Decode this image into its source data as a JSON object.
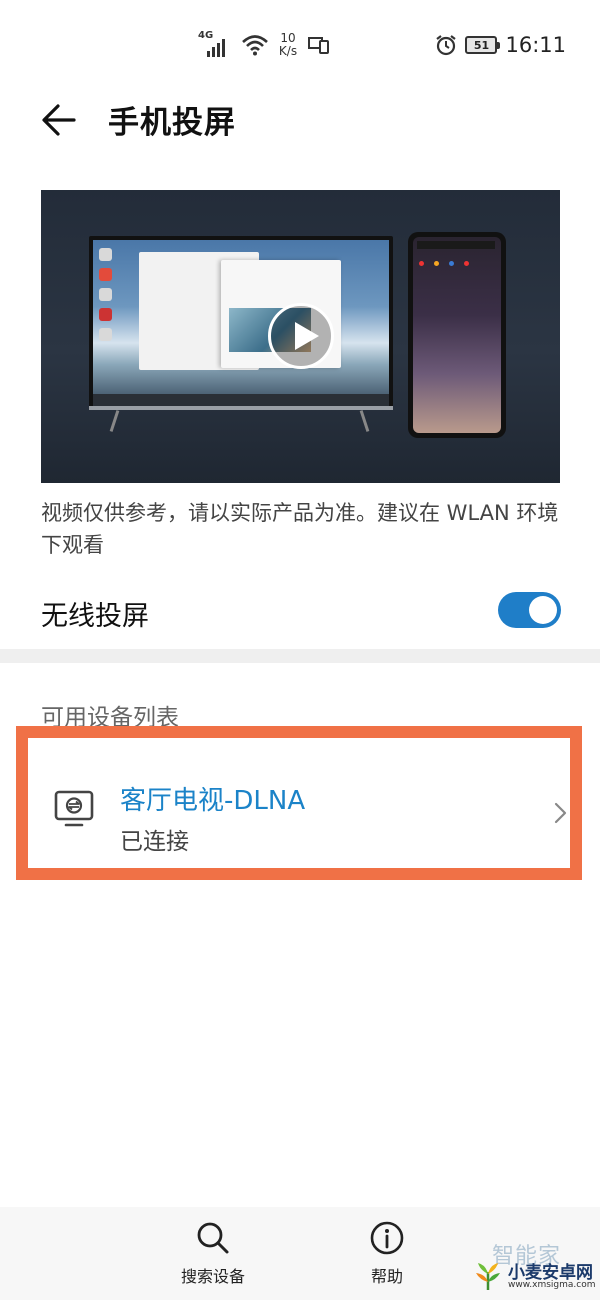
{
  "status_bar": {
    "network_type": "4G",
    "speed_value": "10",
    "speed_unit": "K/s",
    "battery": "51",
    "time": "16:11"
  },
  "header": {
    "title": "手机投屏"
  },
  "video": {
    "note": "视频仅供参考，请以实际产品为准。建议在 WLAN 环境下观看"
  },
  "wireless": {
    "label": "无线投屏",
    "enabled": true,
    "accent_color": "#1f7ec8"
  },
  "devices": {
    "section_title": "可用设备列表",
    "items": [
      {
        "name": "客厅电视-DLNA",
        "status": "已连接",
        "icon": "tv-cast-icon"
      }
    ],
    "highlight_color": "#f07146"
  },
  "bottom_bar": {
    "search_label": "搜索设备",
    "help_label": "帮助"
  },
  "watermark": {
    "faded_text": "智能家",
    "name": "小麦安卓网",
    "url": "www.xmsigma.com"
  }
}
